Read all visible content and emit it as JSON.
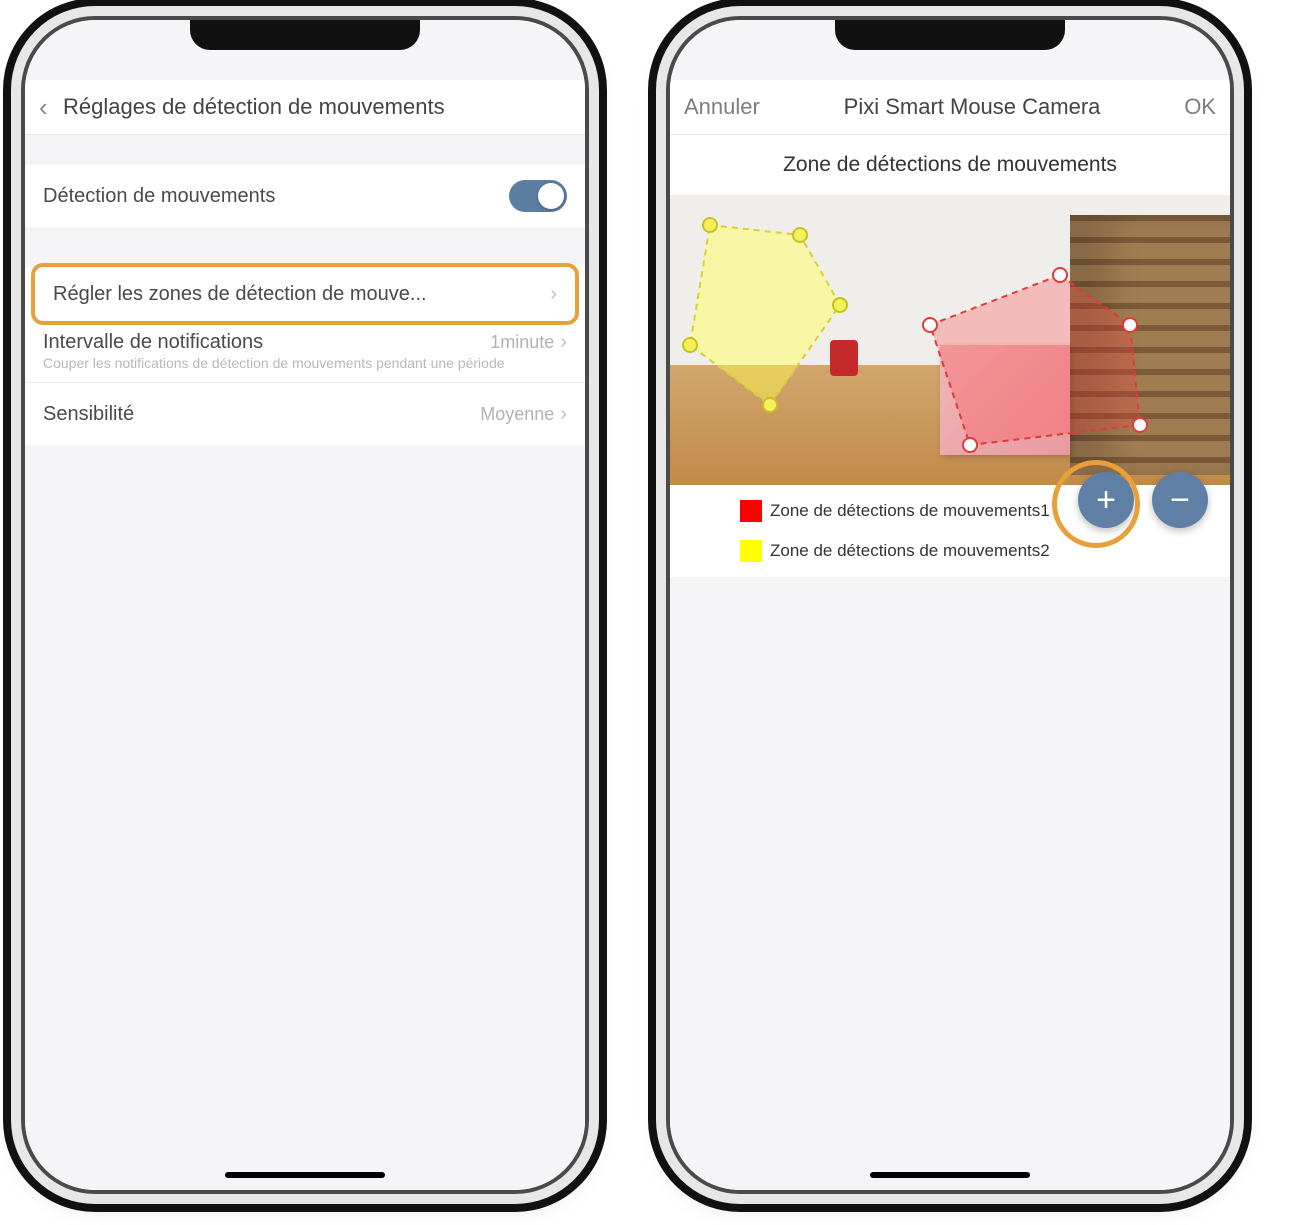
{
  "left": {
    "header_title": "Réglages de détection de mouvements",
    "row_toggle_label": "Détection de mouvements",
    "row_zones_label": "Régler les zones de détection de mouve...",
    "row_interval_label": "Intervalle de notifications",
    "row_interval_sub": "Couper les notifications de détection de mouvements pendant une période",
    "row_interval_value": "1minute",
    "row_sens_label": "Sensibilité",
    "row_sens_value": "Moyenne"
  },
  "right": {
    "header_cancel": "Annuler",
    "header_title": "Pixi Smart Mouse Camera",
    "header_ok": "OK",
    "subheader": "Zone de détections de mouvements",
    "zones": [
      {
        "label": "Zone de détections de mouvements1",
        "color": "#ff0000"
      },
      {
        "label": "Zone de détections de mouvements2",
        "color": "#ffff00"
      }
    ],
    "fab_plus": "+",
    "fab_minus": "−"
  },
  "colors": {
    "highlight": "#e8a13a",
    "accent": "#5f80a4"
  }
}
